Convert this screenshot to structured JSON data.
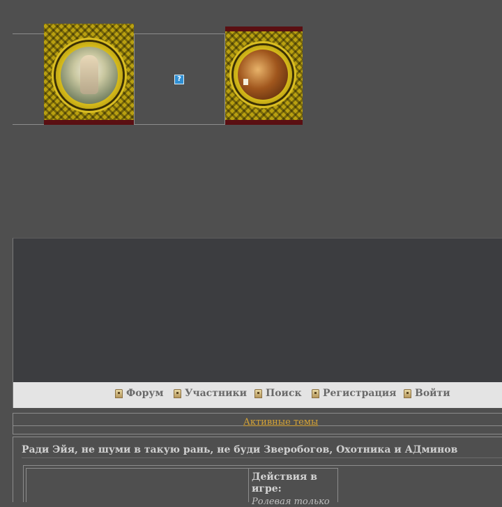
{
  "help_icon": {
    "glyph": "?",
    "icon": "help-icon"
  },
  "navbar": {
    "items": [
      {
        "label": "Форум",
        "icon": "forum-icon"
      },
      {
        "label": "Участники",
        "icon": "members-icon"
      },
      {
        "label": "Поиск",
        "icon": "search-icon"
      },
      {
        "label": "Регистрация",
        "icon": "register-icon"
      },
      {
        "label": "Войти",
        "icon": "login-icon"
      }
    ]
  },
  "active_topics": {
    "label": "Активные темы"
  },
  "topic": {
    "title": "Ради Эйя, не шуми в такую рань, не буди Зверобогов, Охотника и АДминов",
    "cell_heading": "Действия в игре:",
    "cell_subtext": "Ролевая только"
  },
  "colors": {
    "background": "#4f4f4f",
    "dark_panel": "#3c3d40",
    "navbar": "#e4e4e4",
    "link": "#d6a436"
  }
}
